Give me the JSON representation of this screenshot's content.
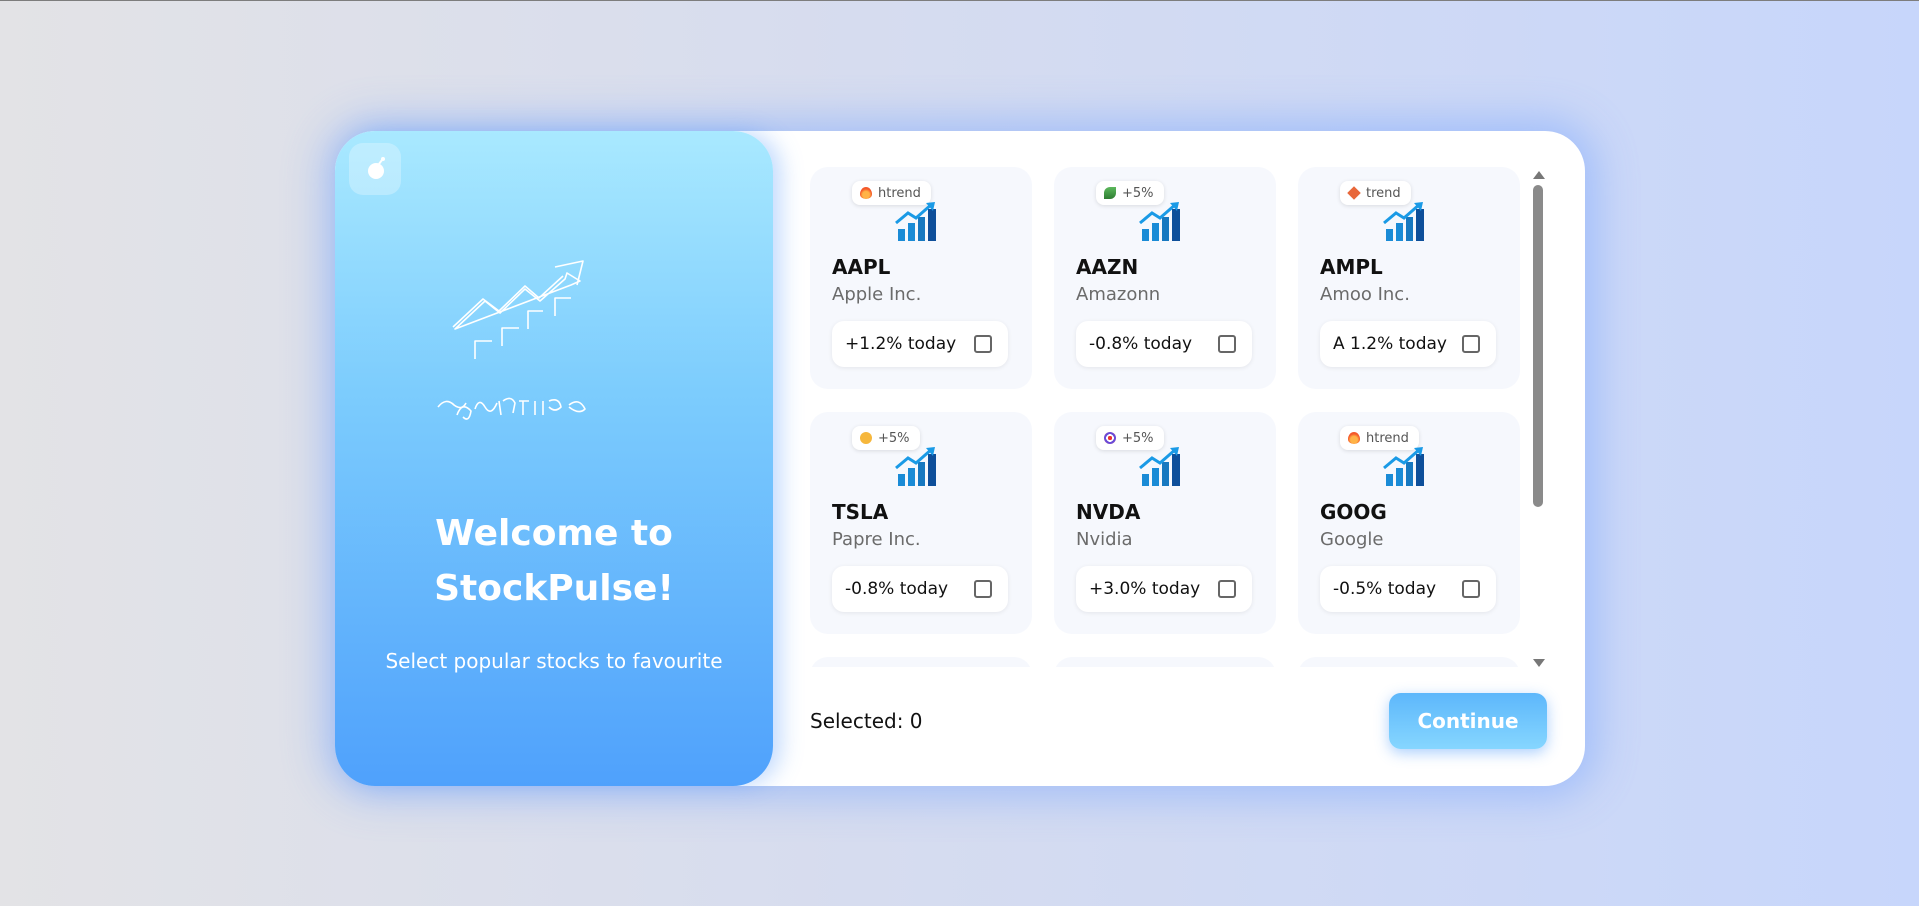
{
  "app": {
    "welcome_line1": "Welcome to",
    "welcome_line2": "StockPulse!",
    "tagline": "Select popular stocks to favourite"
  },
  "stocks": [
    {
      "ticker": "AAPL",
      "company": "Apple Inc.",
      "change": "+1.2% today",
      "badge": "htrend",
      "badge_icon": "fire-icon"
    },
    {
      "ticker": "AAZN",
      "company": "Amazonn",
      "change": "-0.8% today",
      "badge": "+5%",
      "badge_icon": "sprout-icon"
    },
    {
      "ticker": "AMPL",
      "company": "Amoo Inc.",
      "change": "A 1.2% today",
      "badge": "trend",
      "badge_icon": "diamond-icon"
    },
    {
      "ticker": "TSLA",
      "company": "Papre Inc.",
      "change": "-0.8% today",
      "badge": "+5%",
      "badge_icon": "sun-icon"
    },
    {
      "ticker": "NVDA",
      "company": "Nvidia",
      "change": "+3.0% today",
      "badge": "+5%",
      "badge_icon": "target-icon"
    },
    {
      "ticker": "GOOG",
      "company": "Google",
      "change": "-0.5% today",
      "badge": "htrend",
      "badge_icon": "fire-icon"
    }
  ],
  "footer": {
    "selected_label": "Selected: 0",
    "continue_label": "Continue"
  },
  "colors": {
    "accent": "#4fa1fc",
    "panel_top": "#a9e9ff",
    "card_bg": "#f6f8fd"
  }
}
